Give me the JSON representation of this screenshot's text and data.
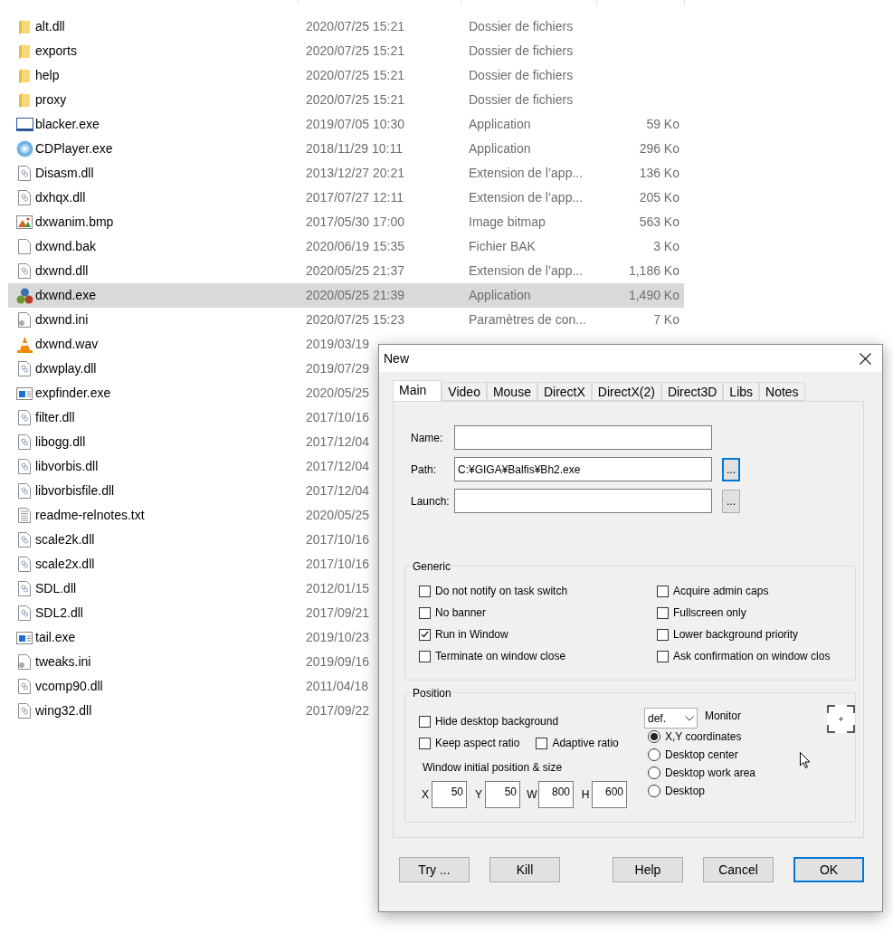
{
  "file_list": {
    "rows": [
      {
        "kind": "folder",
        "name": "alt.dll",
        "date": "2020/07/25 15:21",
        "type": "Dossier de fichiers",
        "selected": false
      },
      {
        "kind": "folder",
        "name": "exports",
        "date": "2020/07/25 15:21",
        "type": "Dossier de fichiers",
        "selected": false
      },
      {
        "kind": "folder",
        "name": "help",
        "date": "2020/07/25 15:21",
        "type": "Dossier de fichiers",
        "selected": false
      },
      {
        "kind": "folder",
        "name": "proxy",
        "date": "2020/07/25 15:21",
        "type": "Dossier de fichiers",
        "selected": false
      },
      {
        "kind": "window",
        "name": "blacker.exe",
        "date": "2019/07/05 10:30",
        "type": "Application",
        "size": "59 Ko",
        "selected": false
      },
      {
        "kind": "disc",
        "name": "CDPlayer.exe",
        "date": "2018/11/29 10:11",
        "type": "Application",
        "size": "296 Ko",
        "selected": false
      },
      {
        "kind": "dll",
        "name": "Disasm.dll",
        "date": "2013/12/27 20:21",
        "type": "Extension de l’app...",
        "size": "136 Ko",
        "selected": false
      },
      {
        "kind": "dll",
        "name": "dxhqx.dll",
        "date": "2017/07/27 12:11",
        "type": "Extension de l’app...",
        "size": "205 Ko",
        "selected": false
      },
      {
        "kind": "bitmap",
        "name": "dxwanim.bmp",
        "date": "2017/05/30 17:00",
        "type": "Image bitmap",
        "size": "563 Ko",
        "selected": false
      },
      {
        "kind": "blank",
        "name": "dxwnd.bak",
        "date": "2020/06/19 15:35",
        "type": "Fichier BAK",
        "size": "3 Ko",
        "selected": false
      },
      {
        "kind": "dll",
        "name": "dxwnd.dll",
        "date": "2020/05/25 21:37",
        "type": "Extension de l’app...",
        "size": "1,186 Ko",
        "selected": false
      },
      {
        "kind": "balls",
        "name": "dxwnd.exe",
        "date": "2020/05/25 21:39",
        "type": "Application",
        "size": "1,490 Ko",
        "selected": true
      },
      {
        "kind": "ini",
        "name": "dxwnd.ini",
        "date": "2020/07/25 15:23",
        "type": "Paramètres de con...",
        "size": "7 Ko",
        "selected": false
      },
      {
        "kind": "cone",
        "name": "dxwnd.wav",
        "date": "2019/03/19",
        "selected": false
      },
      {
        "kind": "dll",
        "name": "dxwplay.dll",
        "date": "2019/07/29",
        "selected": false
      },
      {
        "kind": "app",
        "name": "expfinder.exe",
        "date": "2020/05/25",
        "selected": false
      },
      {
        "kind": "dll",
        "name": "filter.dll",
        "date": "2017/10/16",
        "selected": false
      },
      {
        "kind": "dll",
        "name": "libogg.dll",
        "date": "2017/12/04",
        "selected": false
      },
      {
        "kind": "dll",
        "name": "libvorbis.dll",
        "date": "2017/12/04",
        "selected": false
      },
      {
        "kind": "dll",
        "name": "libvorbisfile.dll",
        "date": "2017/12/04",
        "selected": false
      },
      {
        "kind": "text",
        "name": "readme-relnotes.txt",
        "date": "2020/05/25",
        "selected": false
      },
      {
        "kind": "dll",
        "name": "scale2k.dll",
        "date": "2017/10/16",
        "selected": false
      },
      {
        "kind": "dll",
        "name": "scale2x.dll",
        "date": "2017/10/16",
        "selected": false
      },
      {
        "kind": "dll",
        "name": "SDL.dll",
        "date": "2012/01/15",
        "selected": false
      },
      {
        "kind": "dll",
        "name": "SDL2.dll",
        "date": "2017/09/21",
        "selected": false
      },
      {
        "kind": "app",
        "name": "tail.exe",
        "date": "2019/10/23",
        "selected": false
      },
      {
        "kind": "ini",
        "name": "tweaks.ini",
        "date": "2019/09/16",
        "selected": false
      },
      {
        "kind": "dll",
        "name": "vcomp90.dll",
        "date": "2011/04/18",
        "selected": false
      },
      {
        "kind": "dll",
        "name": "wing32.dll",
        "date": "2017/09/22",
        "selected": false
      }
    ]
  },
  "dialog": {
    "title": "New",
    "tabs": [
      {
        "label": "Main",
        "selected": true
      },
      {
        "label": "Video",
        "selected": false
      },
      {
        "label": "Mouse",
        "selected": false
      },
      {
        "label": "DirectX",
        "selected": false
      },
      {
        "label": "DirectX(2)",
        "selected": false
      },
      {
        "label": "Direct3D",
        "selected": false
      },
      {
        "label": "Libs",
        "selected": false
      },
      {
        "label": "Notes",
        "selected": false
      }
    ],
    "fields": [
      {
        "label": "Name:"
      },
      {
        "label": "Path:",
        "value": "C:¥GIGA¥Balfis¥Bh2.exe",
        "browse": "...",
        "browse_focused": true
      },
      {
        "label": "Launch:",
        "browse": "...",
        "browse_focused": false
      }
    ],
    "generic": {
      "title": "Generic",
      "columns": [
        {
          "items": [
            {
              "label": "Do not notify on task switch",
              "checked": false
            },
            {
              "label": "No banner",
              "checked": false
            },
            {
              "label": "Run in Window",
              "checked": true
            },
            {
              "label": "Terminate on window close",
              "checked": false
            }
          ]
        },
        {
          "items": [
            {
              "label": "Acquire admin caps",
              "checked": false
            },
            {
              "label": "Fullscreen only",
              "checked": false
            },
            {
              "label": "Lower background priority",
              "checked": false
            },
            {
              "label": "Ask confirmation on window clos",
              "checked": false
            }
          ]
        }
      ]
    },
    "position": {
      "title": "Position",
      "checkbox_rows": [
        {
          "items": [
            {
              "label": "Hide desktop background",
              "checked": false
            }
          ]
        },
        {
          "items": [
            {
              "label": "Keep aspect ratio",
              "checked": false
            },
            {
              "label": "Adaptive ratio",
              "checked": false
            }
          ]
        }
      ],
      "size_caption": "Window initial position & size",
      "coords": [
        {
          "label": "X",
          "value": "50"
        },
        {
          "label": "Y",
          "value": "50"
        },
        {
          "label": "W",
          "value": "800"
        },
        {
          "label": "H",
          "value": "600"
        }
      ],
      "monitor_select": "def.",
      "monitor_label": "Monitor",
      "radios": [
        {
          "label": "X,Y coordinates",
          "selected": true
        },
        {
          "label": "Desktop center",
          "selected": false
        },
        {
          "label": "Desktop work area",
          "selected": false
        },
        {
          "label": "Desktop",
          "selected": false
        }
      ]
    },
    "buttons": [
      {
        "label": "Try ...",
        "default": false
      },
      {
        "label": "Kill",
        "default": false
      },
      {
        "label": "Help",
        "default": false
      },
      {
        "label": "Cancel",
        "default": false
      },
      {
        "label": "OK",
        "default": true
      }
    ]
  }
}
